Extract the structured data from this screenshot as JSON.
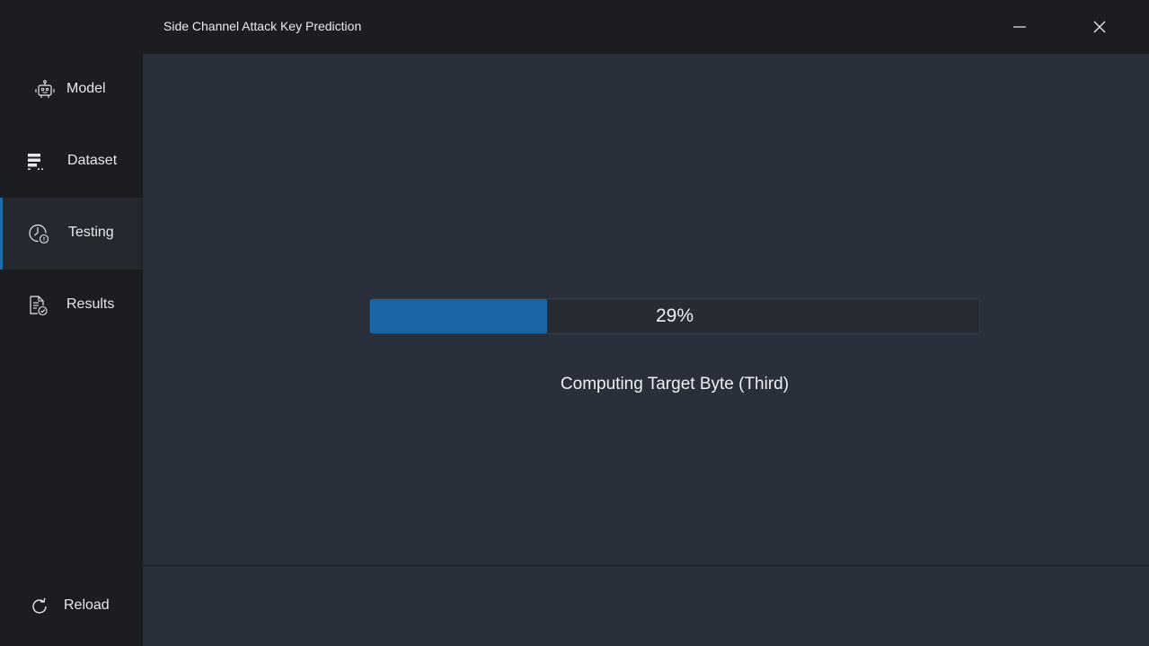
{
  "window": {
    "title": "Side Channel Attack Key Prediction",
    "minimize_icon": "minimize-icon",
    "close_icon": "close-icon"
  },
  "sidebar": {
    "items": [
      {
        "label": "Model",
        "icon": "robot-icon",
        "active": false
      },
      {
        "label": "Dataset",
        "icon": "dataset-icon",
        "active": false
      },
      {
        "label": "Testing",
        "icon": "clock-icon",
        "active": true
      },
      {
        "label": "Results",
        "icon": "document-check-icon",
        "active": false
      }
    ],
    "reload": {
      "label": "Reload",
      "icon": "reload-icon"
    }
  },
  "main": {
    "progress": {
      "percent": 29,
      "text": "29%"
    },
    "status": "Computing Target Byte (Third)"
  },
  "colors": {
    "accent": "#1a65a3",
    "sidebar_bg": "#1b1d21",
    "content_bg": "#2a303b"
  }
}
